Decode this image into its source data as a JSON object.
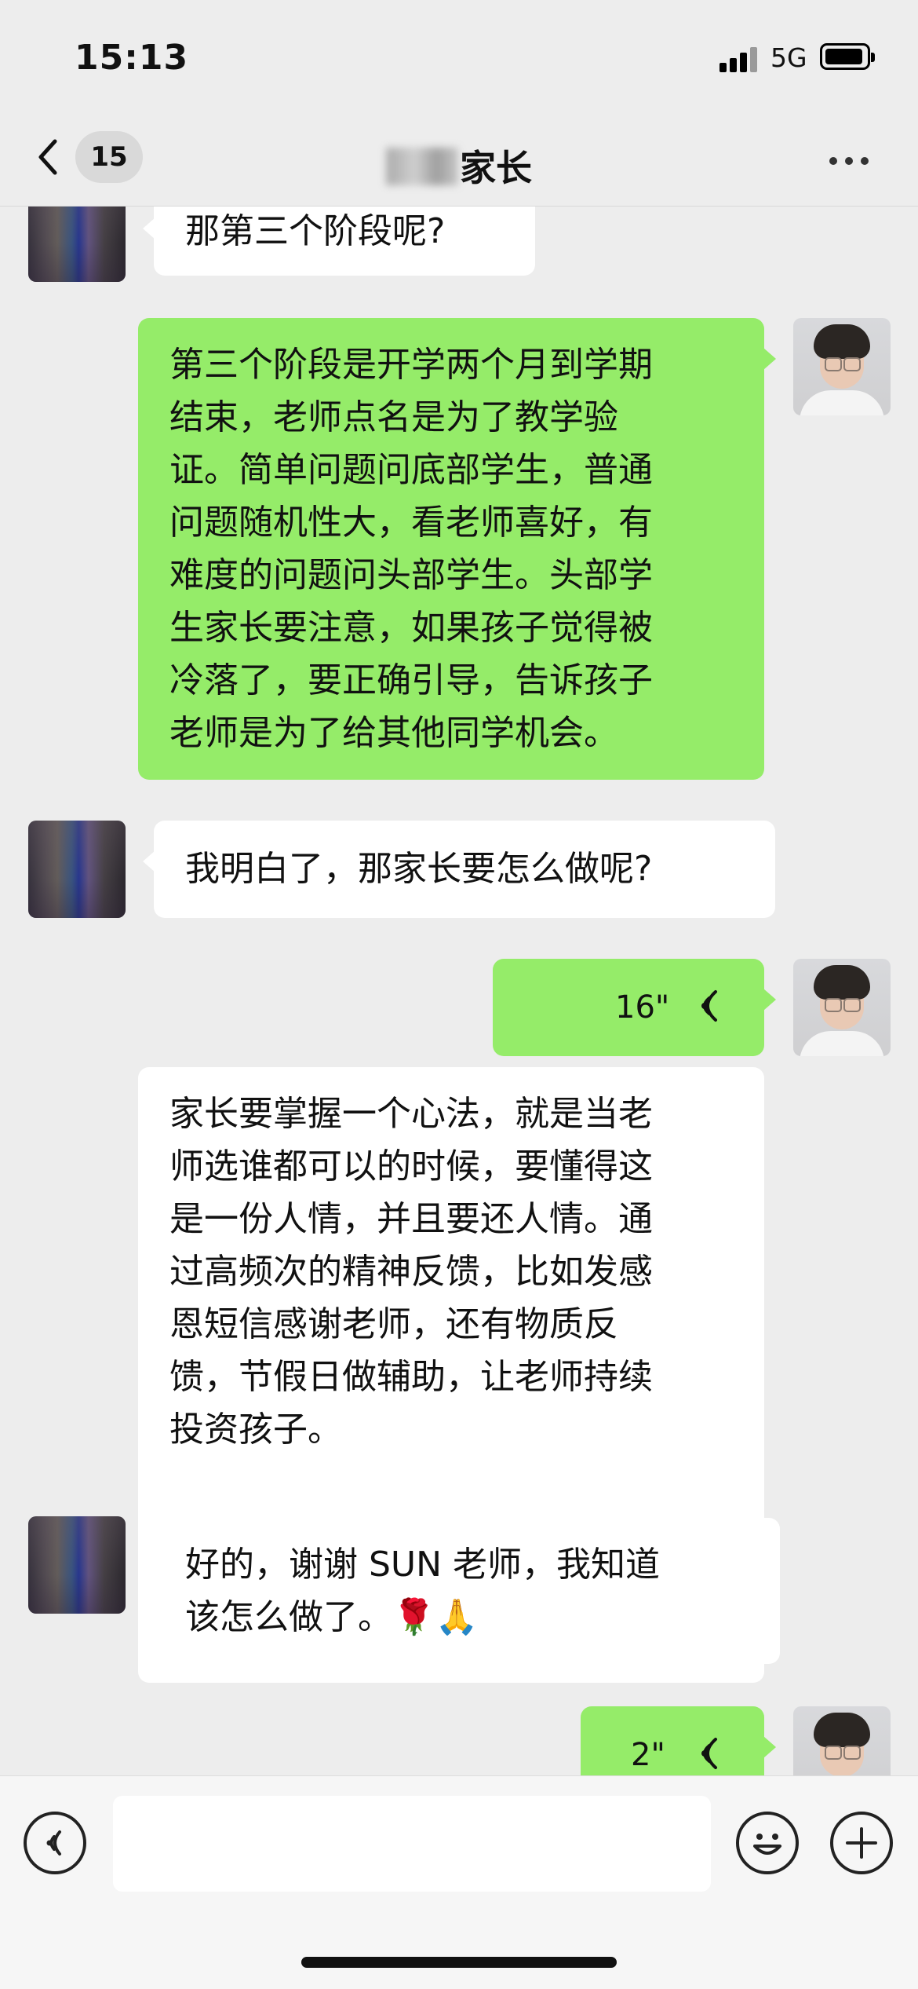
{
  "status_bar": {
    "time": "15:13",
    "network": "5G"
  },
  "nav": {
    "unread_count": "15",
    "title_suffix": "家长"
  },
  "messages": [
    {
      "sender": "parent",
      "type": "text",
      "text": "那第三个阶段呢?"
    },
    {
      "sender": "teacher",
      "type": "text",
      "lines": [
        "第三个阶段是开学两个月到学期",
        "结束，老师点名是为了教学验",
        "证。简单问题问底部学生，普通",
        "问题随机性大，看老师喜好，有",
        "难度的问题问头部学生。头部学",
        "生家长要注意，如果孩子觉得被",
        "冷落了，要正确引导，告诉孩子",
        "老师是为了给其他同学机会。"
      ]
    },
    {
      "sender": "parent",
      "type": "text",
      "text": "我明白了，那家长要怎么做呢?"
    },
    {
      "sender": "teacher",
      "type": "voice",
      "duration": "16\""
    },
    {
      "sender": "teacher",
      "type": "text",
      "lines": [
        "家长要掌握一个心法，就是当老",
        "师选谁都可以的时候，要懂得这",
        "是一份人情，并且要还人情。通",
        "过高频次的精神反馈，比如发感",
        "恩短信感谢老师，还有物质反",
        "馈，节假日做辅助，让老师持续",
        "投资孩子。"
      ]
    },
    {
      "sender": "parent",
      "type": "text",
      "lines": [
        "好的，谢谢 SUN 老师，我知道",
        "该怎么做了。🌹🙏"
      ]
    },
    {
      "sender": "teacher",
      "type": "voice",
      "duration": "2\""
    }
  ],
  "icons": {
    "back": "chevron-left-icon",
    "more": "more-dots-icon",
    "voice_input": "voice-mode-icon",
    "emoji": "emoji-icon",
    "add": "plus-icon"
  },
  "colors": {
    "background": "#ededed",
    "sent_bubble": "#95ec69",
    "received_bubble": "#ffffff"
  }
}
